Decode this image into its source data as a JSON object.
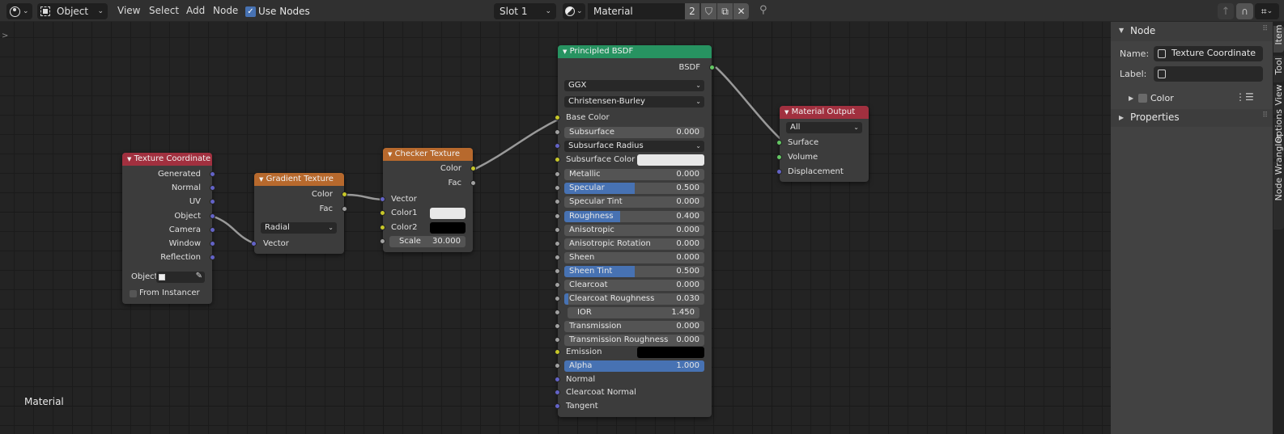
{
  "header": {
    "editor_type_icon": "node-editor-icon",
    "mode": "Object",
    "menus": [
      "View",
      "Select",
      "Add",
      "Node"
    ],
    "use_nodes_label": "Use Nodes",
    "use_nodes_checked": true,
    "slot": "Slot 1",
    "material_name": "Material",
    "user_count": "2"
  },
  "canvas": {
    "label": "Material",
    "toolbar_toggle": ">"
  },
  "sidebar": {
    "node_panel_title": "Node",
    "name_label": "Name:",
    "name_value": "Texture Coordinate",
    "label_label": "Label:",
    "label_value": "",
    "color_label": "Color",
    "properties_title": "Properties",
    "tabs": [
      "Item",
      "Tool",
      "View",
      "Options",
      "Node Wrangler"
    ]
  },
  "nodes": {
    "texcoord": {
      "title": "Texture Coordinate",
      "outputs": [
        "Generated",
        "Normal",
        "UV",
        "Object",
        "Camera",
        "Window",
        "Reflection"
      ],
      "object_label": "Object:",
      "from_instancer": "From Instancer",
      "color": "#a1303f"
    },
    "gradient": {
      "title": "Gradient Texture",
      "outputs": [
        "Color",
        "Fac"
      ],
      "type": "Radial",
      "input": "Vector",
      "color": "#b7692d"
    },
    "checker": {
      "title": "Checker Texture",
      "outputs": [
        "Color",
        "Fac"
      ],
      "inputs": [
        "Vector",
        "Color1",
        "Color2"
      ],
      "scale_label": "Scale",
      "scale_value": "30.000",
      "color1": "#e8e8e8",
      "color2": "#000000",
      "color": "#b7692d"
    },
    "bsdf": {
      "title": "Principled BSDF",
      "output": "BSDF",
      "distribution": "GGX",
      "subsurface_method": "Christensen-Burley",
      "base_color": "Base Color",
      "subsurface_radius": "Subsurface Radius",
      "subsurface_color": "Subsurface Color",
      "emission": "Emission",
      "normal": "Normal",
      "clearcoat_normal": "Clearcoat Normal",
      "tangent": "Tangent",
      "fields": [
        {
          "label": "Subsurface",
          "value": "0.000",
          "fraction": 0
        },
        {
          "label": "Metallic",
          "value": "0.000",
          "fraction": 0
        },
        {
          "label": "Specular",
          "value": "0.500",
          "fraction": 0.5
        },
        {
          "label": "Specular Tint",
          "value": "0.000",
          "fraction": 0
        },
        {
          "label": "Roughness",
          "value": "0.400",
          "fraction": 0.4
        },
        {
          "label": "Anisotropic",
          "value": "0.000",
          "fraction": 0
        },
        {
          "label": "Anisotropic Rotation",
          "value": "0.000",
          "fraction": 0
        },
        {
          "label": "Sheen",
          "value": "0.000",
          "fraction": 0
        },
        {
          "label": "Sheen Tint",
          "value": "0.500",
          "fraction": 0.5
        },
        {
          "label": "Clearcoat",
          "value": "0.000",
          "fraction": 0
        },
        {
          "label": "Clearcoat Roughness",
          "value": "0.030",
          "fraction": 0.03
        },
        {
          "label": "IOR",
          "value": "1.450",
          "fraction": 0
        },
        {
          "label": "Transmission",
          "value": "0.000",
          "fraction": 0
        },
        {
          "label": "Transmission Roughness",
          "value": "0.000",
          "fraction": 0
        },
        {
          "label": "Alpha",
          "value": "1.000",
          "fraction": 1
        }
      ],
      "subsurface_color_value": "#e8e8e8",
      "emission_color_value": "#000000",
      "color": "#279361"
    },
    "output": {
      "title": "Material Output",
      "target": "All",
      "inputs": [
        "Surface",
        "Volume",
        "Displacement"
      ],
      "color": "#a1303f"
    }
  }
}
